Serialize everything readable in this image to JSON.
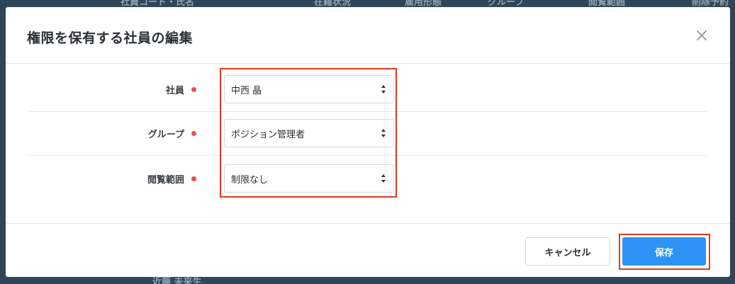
{
  "background": {
    "header_columns": [
      "社員コード・氏名",
      "在籍状況",
      "雇用形態",
      "グループ",
      "閲覧範囲",
      "削除予約"
    ],
    "footer_text": "近藤 未来生"
  },
  "modal": {
    "title": "権限を保有する社員の編集",
    "close_icon": "close-icon",
    "fields": [
      {
        "label": "社員",
        "value": "中西 晶",
        "required": true
      },
      {
        "label": "グループ",
        "value": "ポジション管理者",
        "required": true
      },
      {
        "label": "閲覧範囲",
        "value": "制限なし",
        "required": true
      }
    ],
    "cancel_label": "キャンセル",
    "save_label": "保存"
  },
  "colors": {
    "accent": "#2f93f5",
    "required_dot": "#ee4e4e",
    "highlight": "#e23a1f",
    "overlay": "#2f4658"
  }
}
